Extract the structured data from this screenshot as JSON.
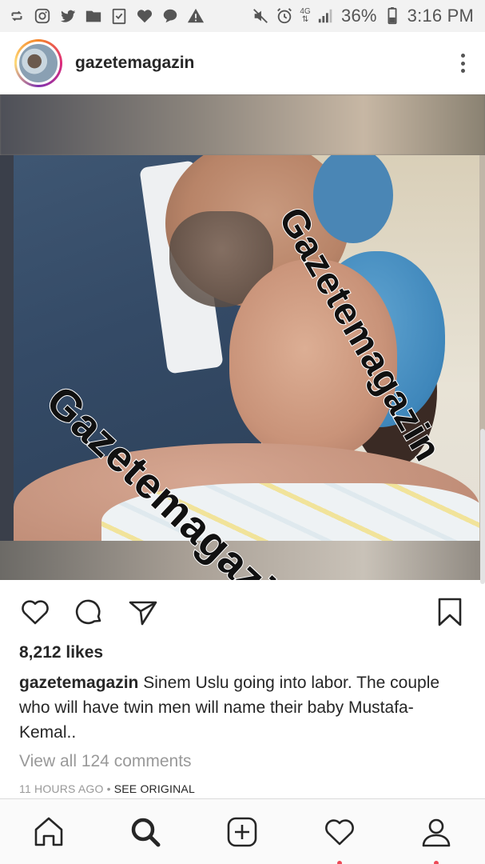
{
  "status_bar": {
    "network_label": "4G",
    "battery_text": "36%",
    "time_text": "3:16 PM",
    "left_icons": [
      "repost-icon",
      "instagram-icon",
      "twitter-icon",
      "folder-icon",
      "clipboard-check-icon",
      "heart-notification-icon",
      "chat-bubble-icon",
      "warning-icon"
    ],
    "right_icons": [
      "mute-icon",
      "alarm-icon",
      "network-arrows-icon",
      "signal-icon",
      "battery-icon"
    ]
  },
  "post": {
    "username": "gazetemagazin",
    "more_icon": "more-vertical-icon",
    "watermark_1": "Gazetemagazin",
    "watermark_2": "Gazetemagazin",
    "likes_text": "8,212 likes",
    "caption_user": "gazetemagazin",
    "caption_text": " Sinem Uslu going into labor. The couple who will have twin men will name their baby Mustafa-Kemal..",
    "view_comments_text": "View all 124 comments",
    "timestamp_text": "11 HOURS AGO",
    "separator": "•",
    "see_original_text": "SEE ORIGINAL"
  },
  "actions": {
    "like_icon": "heart-icon",
    "comment_icon": "comment-icon",
    "share_icon": "direct-share-icon",
    "save_icon": "bookmark-icon"
  },
  "bottom_nav": {
    "items": [
      "home-icon",
      "search-icon",
      "add-post-icon",
      "activity-heart-icon",
      "profile-icon"
    ],
    "accent_dot_color": "#ed4956"
  },
  "colors": {
    "text_primary": "#262626",
    "text_secondary": "#999999",
    "cap_blue": "#3f87bb"
  }
}
